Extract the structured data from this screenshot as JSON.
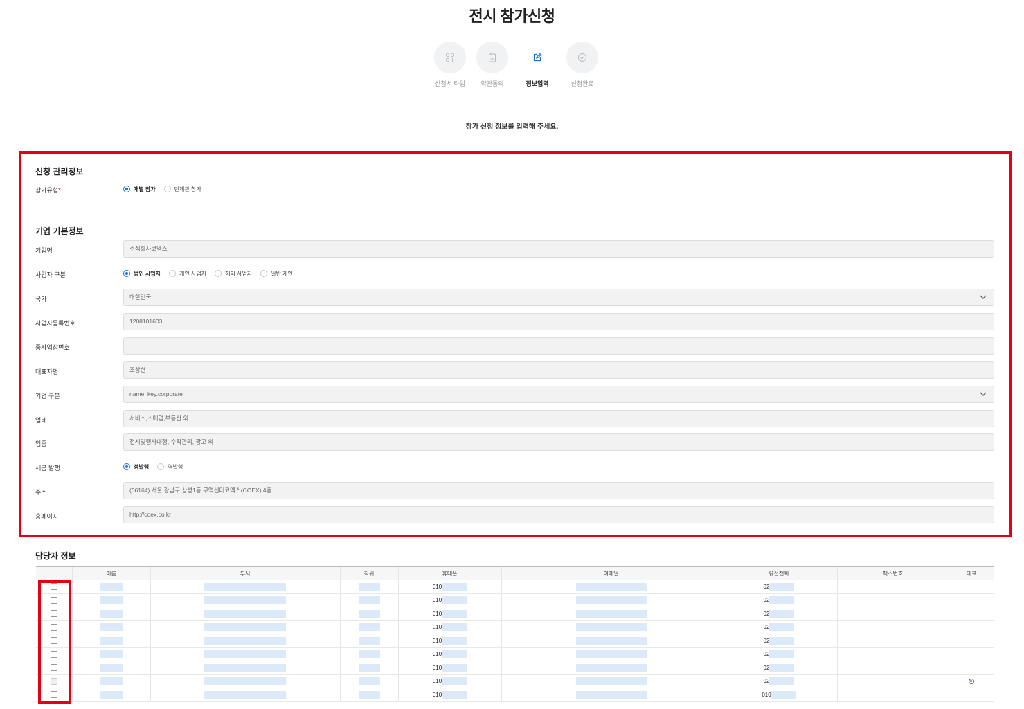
{
  "page_title": "전시 참가신청",
  "steps": [
    {
      "label": "신청서 타입",
      "icon": "grid-icon",
      "active": false
    },
    {
      "label": "약관동의",
      "icon": "clipboard-icon",
      "active": false
    },
    {
      "label": "정보입력",
      "icon": "edit-icon",
      "active": true
    },
    {
      "label": "신청완료",
      "icon": "check-circle-icon",
      "active": false
    }
  ],
  "intro": "참가 신청 정보를 입력해 주세요.",
  "management": {
    "title": "신청 관리정보",
    "participation_type": {
      "label": "참가유형",
      "required_mark": "*",
      "options": [
        "개별 참가",
        "단체관 참가"
      ],
      "selected": "개별 참가"
    }
  },
  "company": {
    "title": "기업 기본정보",
    "name": {
      "label": "기업명",
      "value": "주식회사코엑스"
    },
    "business_type": {
      "label": "사업자 구분",
      "options": [
        "법인 사업자",
        "개인 사업자",
        "해외 사업자",
        "일반 개인"
      ],
      "selected": "법인 사업자"
    },
    "country": {
      "label": "국가",
      "value": "대한민국"
    },
    "biz_reg_no": {
      "label": "사업자등록번호",
      "value": "1208101603"
    },
    "main_biz_no": {
      "label": "종사업장번호",
      "value": ""
    },
    "ceo": {
      "label": "대표자명",
      "value": "조상현"
    },
    "company_type": {
      "label": "기업 구분",
      "value": "name_key.corporate"
    },
    "industry": {
      "label": "업태",
      "value": "서비스,소매업,부동산 외"
    },
    "category": {
      "label": "업종",
      "value": "전시및행사대행, 수탁관리, 광고 외"
    },
    "tax_invoice": {
      "label": "세금 발행",
      "options": [
        "정발행",
        "역발행"
      ],
      "selected": "정발행"
    },
    "address": {
      "label": "주소",
      "value": "(06164) 서울 강남구 삼성1동 무역센터코엑스(COEX) 4층"
    },
    "homepage": {
      "label": "홈페이지",
      "value": "http://coex.co.kr"
    }
  },
  "contacts": {
    "title": "담당자 정보",
    "columns": [
      "",
      "이름",
      "부서",
      "직위",
      "휴대폰",
      "이메일",
      "유선전화",
      "팩스번호",
      "대표"
    ],
    "rows": [
      {
        "checked": false,
        "disabled": false,
        "mobile": "010",
        "phone": "02",
        "rep": false
      },
      {
        "checked": false,
        "disabled": false,
        "mobile": "010",
        "phone": "02",
        "rep": false
      },
      {
        "checked": false,
        "disabled": false,
        "mobile": "010",
        "phone": "02",
        "rep": false
      },
      {
        "checked": false,
        "disabled": false,
        "mobile": "010",
        "phone": "02",
        "rep": false
      },
      {
        "checked": false,
        "disabled": false,
        "mobile": "010",
        "phone": "02",
        "rep": false
      },
      {
        "checked": false,
        "disabled": false,
        "mobile": "010",
        "phone": "02",
        "rep": false
      },
      {
        "checked": false,
        "disabled": false,
        "mobile": "010",
        "phone": "02",
        "rep": false
      },
      {
        "checked": true,
        "disabled": true,
        "mobile": "010",
        "phone": "02",
        "rep": true
      },
      {
        "checked": false,
        "disabled": false,
        "mobile": "010",
        "phone": "010",
        "rep": false
      }
    ]
  },
  "colors": {
    "accent": "#1a6fd8",
    "highlight": "#e60012",
    "field_bg": "#f2f2f2"
  }
}
